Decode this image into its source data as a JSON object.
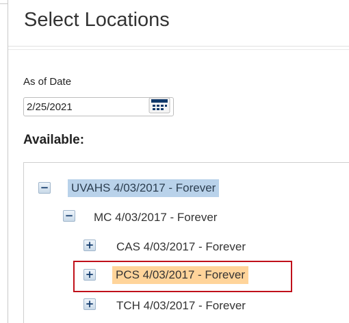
{
  "dialog": {
    "title": "Select Locations"
  },
  "as_of_date": {
    "label": "As of Date",
    "value": "2/25/2021"
  },
  "available": {
    "heading": "Available:"
  },
  "tree": {
    "nodes": [
      {
        "toggle": "−",
        "label": "UVAHS 4/03/2017 - Forever",
        "state": "selected"
      },
      {
        "toggle": "−",
        "label": "MC 4/03/2017 - Forever",
        "state": "normal"
      },
      {
        "toggle": "+",
        "label": "CAS 4/03/2017 - Forever",
        "state": "normal"
      },
      {
        "toggle": "+",
        "label": "PCS 4/03/2017 - Forever",
        "state": "focused"
      },
      {
        "toggle": "+",
        "label": "TCH 4/03/2017 - Forever",
        "state": "normal"
      }
    ]
  },
  "colors": {
    "selected_bg": "#b9d2ea",
    "focused_bg": "#ffd49a",
    "focus_ring": "#c0101a",
    "toggle_text": "#123a6b"
  }
}
